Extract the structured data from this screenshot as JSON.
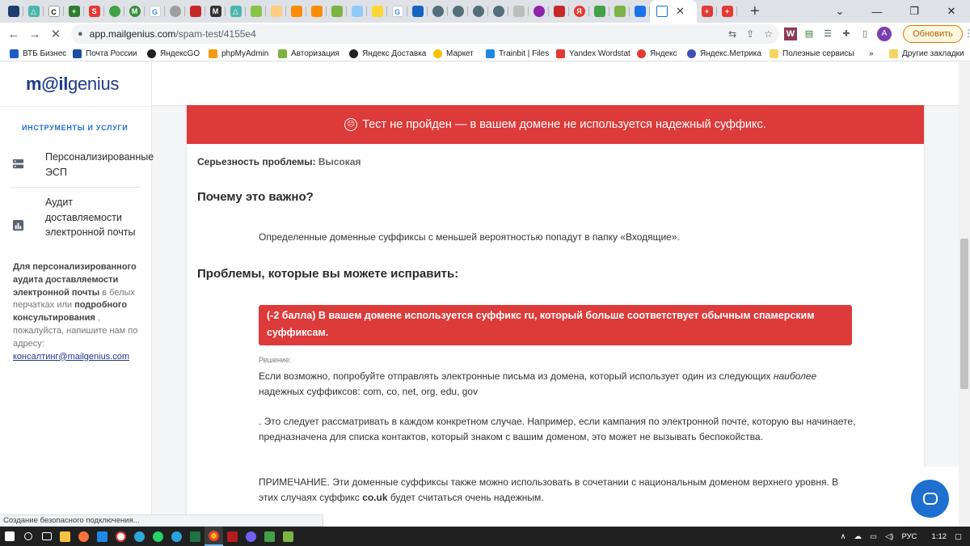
{
  "browser": {
    "url_host": "app.mailgenius.com",
    "url_path": "/spam-test/4155e4",
    "update_label": "Обновить",
    "avatar_letter": "A",
    "bookmarks": [
      {
        "label": "ВТБ Бизнес",
        "color": "#1e5bc6"
      },
      {
        "label": "Почта России",
        "color": "#1c4fa1"
      },
      {
        "label": "ЯндексGO",
        "color": "#222"
      },
      {
        "label": "phpMyAdmin",
        "color": "#f29b0c"
      },
      {
        "label": "Авторизация",
        "color": "#7cb342"
      },
      {
        "label": "Яндекс Доставка",
        "color": "#222"
      },
      {
        "label": "Маркет",
        "color": "#f5c400"
      },
      {
        "label": "Trainbit | Files",
        "color": "#1e88e5"
      },
      {
        "label": "Yandex Wordstat",
        "color": "#e53935"
      },
      {
        "label": "Яндекс",
        "color": "#e53935"
      },
      {
        "label": "Яндекс.Метрика",
        "color": "#3f51b5"
      },
      {
        "label": "Полезные сервисы",
        "color": "#f6d365"
      }
    ],
    "other_bookmarks": "Другие закладки",
    "status_text": "Создание безопасного подключения..."
  },
  "sidebar": {
    "logo_prefix": "m@il",
    "logo_suffix": "genius",
    "heading": "ИНСТРУМЕНТЫ И УСЛУГИ",
    "items": [
      {
        "label": "Персонализированные ЭСП"
      },
      {
        "label": "Аудит доставляемости электронной почты"
      }
    ],
    "note_part1": "Для персонализированного аудита доставляемости электронной почты",
    "note_part2": " в белых перчатках или ",
    "note_part3": "подробного консультирования",
    "note_part4": " , пожалуйста, напишите нам по адресу: ",
    "note_email": "консалтинг@mailgenius.com"
  },
  "main": {
    "fail_banner": "Тест не пройден — в вашем домене не используется надежный суффикс.",
    "severity_label": "Серьезность проблемы:",
    "severity_value": "Высокая",
    "why_heading": "Почему это важно?",
    "why_text": "Определенные доменные суффиксы с меньшей вероятностью попадут в папку «Входящие».",
    "fix_heading": "Проблемы, которые вы можете исправить:",
    "issue_text": "(-2 балла) В вашем домене используется суффикс ru, который больше соответствует обычным спамерским суффиксам.",
    "solution_label": "Решение:",
    "sol_p1_a": "Если возможно, попробуйте отправлять электронные письма из домена, который использует один из следующих ",
    "sol_p1_em": "наиболее",
    "sol_p1_b": " надежных суффиксов: com, co, net, org, edu, gov",
    "sol_p2": ". Это следует рассматривать в каждом конкретном случае. Например, если кампания по электронной почте, которую вы начинаете, предназначена для списка контактов, который знаком с вашим доменом, это может не вызывать беспокойства.",
    "sol_p3_a": "ПРИМЕЧАНИЕ. Эти доменные суффиксы также можно использовать в сочетании с национальным доменом верхнего уровня. В этих случаях суффикс ",
    "sol_p3_b": "co.uk",
    "sol_p3_c": " будет считаться очень надежным."
  },
  "taskbar": {
    "lang": "РУС",
    "time": "1:12"
  },
  "colors": {
    "accent_red": "#dd3a3a",
    "brand_blue": "#1e3a8a",
    "chat_blue": "#1d6fd0"
  }
}
